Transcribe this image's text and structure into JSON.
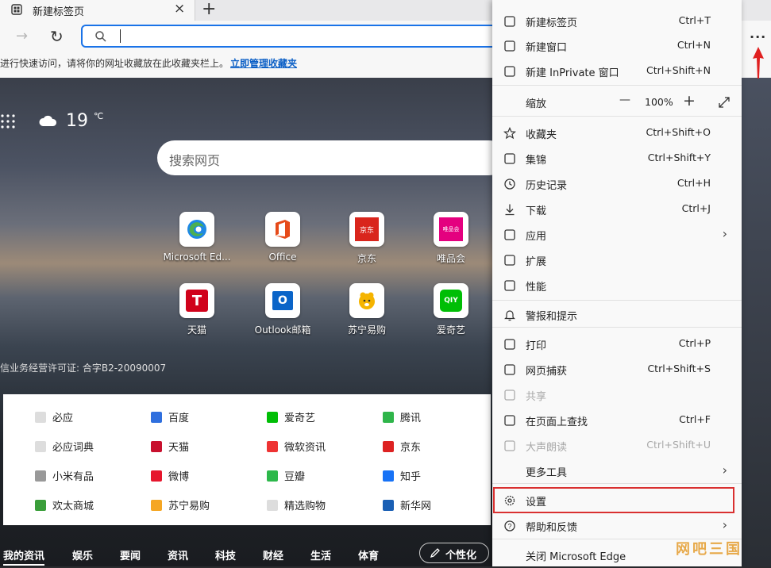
{
  "tab": {
    "title": "新建标签页",
    "close": "×",
    "new": "+"
  },
  "toolbar": {
    "forward": "→",
    "reload": "↻",
    "more": "···"
  },
  "address": {
    "value": ""
  },
  "favbar": {
    "message": "进行快速访问，请将你的网址收藏放在此收藏夹栏上。",
    "link": "立即管理收藏夹"
  },
  "ntp": {
    "temperature": "19",
    "temp_unit": "℃",
    "search_placeholder": "搜索网页",
    "quick_links": [
      {
        "label": "Microsoft Ed...",
        "icon": "edge-icon"
      },
      {
        "label": "Office",
        "icon": "office-icon"
      },
      {
        "label": "京东",
        "icon": "jd-icon",
        "text": "京东"
      },
      {
        "label": "唯品会",
        "icon": "vip-icon",
        "text": "唯品会"
      },
      {
        "label": "天猫",
        "icon": "tmall-icon",
        "text": "T"
      },
      {
        "label": "Outlook邮箱",
        "icon": "outlook-icon",
        "text": "O"
      },
      {
        "label": "苏宁易购",
        "icon": "suning-icon"
      },
      {
        "label": "爱奇艺",
        "icon": "iqiyi-icon",
        "text": "QIY"
      }
    ],
    "license": "信业务经营许可证: 合字B2-20090007",
    "right_fragment": "§?",
    "links": [
      [
        "必应",
        "百度",
        "爱奇艺",
        "腾讯"
      ],
      [
        "必应词典",
        "天猫",
        "微软资讯",
        "京东"
      ],
      [
        "小米有品",
        "微博",
        "豆瓣",
        "知乎"
      ],
      [
        "欢太商城",
        "苏宁易购",
        "精选购物",
        "新华网"
      ]
    ],
    "feed_tabs": [
      "我的资讯",
      "娱乐",
      "要闻",
      "资讯",
      "科技",
      "财经",
      "生活",
      "体育"
    ],
    "personalize": "个性化"
  },
  "menu": {
    "items": [
      {
        "label": "新建标签页",
        "shortcut": "Ctrl+T"
      },
      {
        "label": "新建窗口",
        "shortcut": "Ctrl+N"
      },
      {
        "label": "新建 InPrivate 窗口",
        "shortcut": "Ctrl+Shift+N"
      },
      {
        "label": "缩放",
        "zoom": "100%",
        "minus": "—",
        "plus": "+"
      },
      {
        "label": "收藏夹",
        "shortcut": "Ctrl+Shift+O"
      },
      {
        "label": "集锦",
        "shortcut": "Ctrl+Shift+Y"
      },
      {
        "label": "历史记录",
        "shortcut": "Ctrl+H"
      },
      {
        "label": "下载",
        "shortcut": "Ctrl+J"
      },
      {
        "label": "应用",
        "shortcut": ""
      },
      {
        "label": "扩展",
        "shortcut": ""
      },
      {
        "label": "性能",
        "shortcut": ""
      },
      {
        "label": "警报和提示",
        "shortcut": ""
      },
      {
        "label": "打印",
        "shortcut": "Ctrl+P"
      },
      {
        "label": "网页捕获",
        "shortcut": "Ctrl+Shift+S"
      },
      {
        "label": "共享",
        "shortcut": ""
      },
      {
        "label": "在页面上查找",
        "shortcut": "Ctrl+F"
      },
      {
        "label": "大声朗读",
        "shortcut": "Ctrl+Shift+U"
      },
      {
        "label": "更多工具",
        "shortcut": ""
      },
      {
        "label": "设置",
        "shortcut": ""
      },
      {
        "label": "帮助和反馈",
        "shortcut": ""
      },
      {
        "label": "关闭 Microsoft Edge",
        "shortcut": ""
      }
    ]
  },
  "watermark": "网吧三国",
  "colors": {
    "accent": "#1a73e8",
    "highlight": "#d93030",
    "link": "#0b5fc6"
  }
}
